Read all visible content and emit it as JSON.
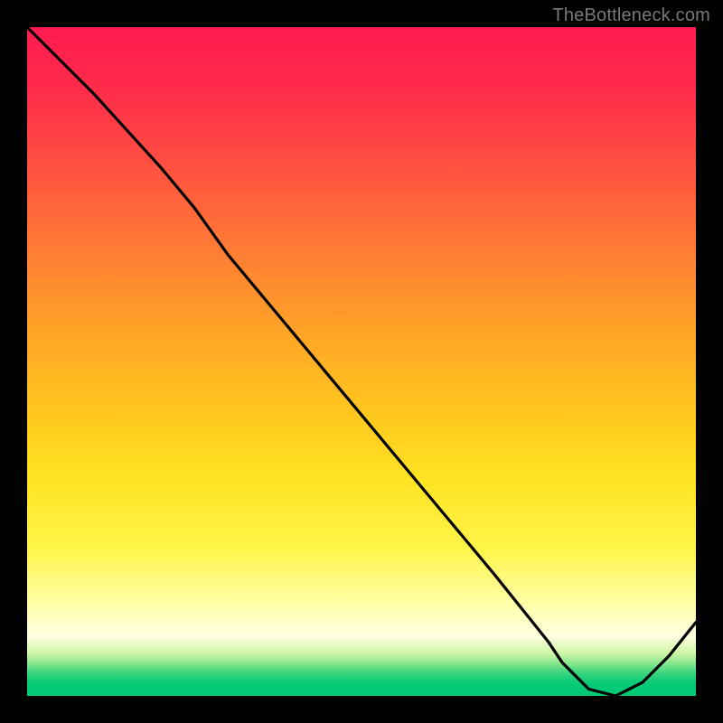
{
  "attribution": {
    "text": "TheBottleneck.com"
  },
  "colors": {
    "page_bg": "#000000",
    "curve": "#000000",
    "watermark": "#787878",
    "valley_label": "#ff2a2a",
    "gradient_top": "#ff1a4f",
    "gradient_bottom": "#00c974"
  },
  "valley": {
    "label": ""
  },
  "chart_data": {
    "type": "line",
    "title": "",
    "xlabel": "",
    "ylabel": "",
    "xlim": [
      0,
      100
    ],
    "ylim": [
      0,
      100
    ],
    "grid": false,
    "legend": false,
    "series": [
      {
        "name": "bottleneck-curve",
        "x": [
          0,
          10,
          20,
          25,
          30,
          40,
          50,
          60,
          70,
          78,
          80,
          84,
          88,
          92,
          96,
          100
        ],
        "values": [
          100,
          90,
          79,
          73,
          66,
          54,
          42,
          30,
          18,
          8,
          5,
          1,
          0,
          2,
          6,
          11
        ]
      }
    ],
    "annotations": [
      {
        "type": "valley-marker",
        "x": 86,
        "y": 0,
        "text": ""
      }
    ],
    "description": "Single black curve descending steeply from top-left, slight elbow near x≈25, reaching a minimum (touching 0) around x≈86–88, then rising toward the right edge. Background is a vertical red→orange→yellow→pale→green gradient representing bottleneck severity (red high, green low)."
  }
}
